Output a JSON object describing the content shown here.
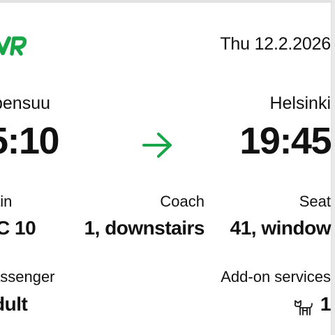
{
  "brand": {
    "accent": "#17a648",
    "logo_text": "VR",
    "arrow_icon": "arrow-right-icon",
    "addon_icon": "dog-icon"
  },
  "ticket": {
    "date": "Thu 12.2.2026",
    "from": {
      "station": "bensuu",
      "time": "5:10"
    },
    "to": {
      "station": "Helsinki",
      "time": "19:45"
    },
    "train": {
      "label": "ain",
      "value": "C 10"
    },
    "coach": {
      "label": "Coach",
      "value": "1, downstairs"
    },
    "seat": {
      "label": "Seat",
      "value": "41, window"
    },
    "passenger": {
      "label": "assenger",
      "value": "dult"
    },
    "addons": {
      "label": "Add-on services",
      "count": "1"
    }
  }
}
